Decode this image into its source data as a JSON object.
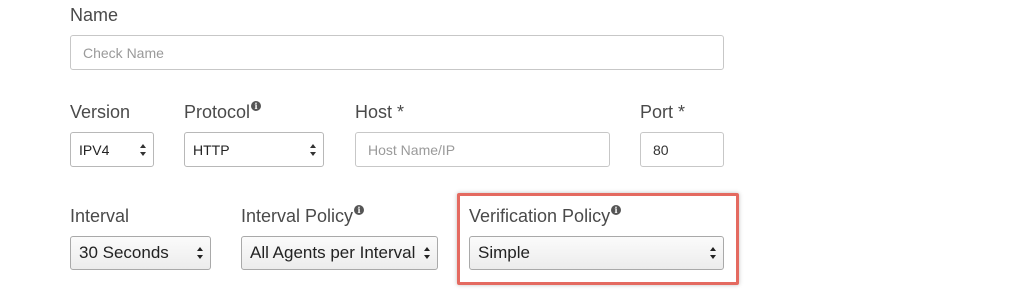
{
  "name": {
    "label": "Name",
    "placeholder": "Check Name",
    "value": ""
  },
  "version": {
    "label": "Version",
    "selected": "IPV4"
  },
  "protocol": {
    "label": "Protocol",
    "selected": "HTTP",
    "info_icon": "info-icon"
  },
  "host": {
    "label": "Host *",
    "placeholder": "Host Name/IP",
    "value": ""
  },
  "port": {
    "label": "Port *",
    "value": "80"
  },
  "interval": {
    "label": "Interval",
    "selected": "30 Seconds"
  },
  "interval_policy": {
    "label": "Interval Policy",
    "selected": "All Agents per Interval",
    "info_icon": "info-icon"
  },
  "verification_policy": {
    "label": "Verification Policy",
    "selected": "Simple",
    "info_icon": "info-icon",
    "highlight_color": "#e46a60"
  }
}
